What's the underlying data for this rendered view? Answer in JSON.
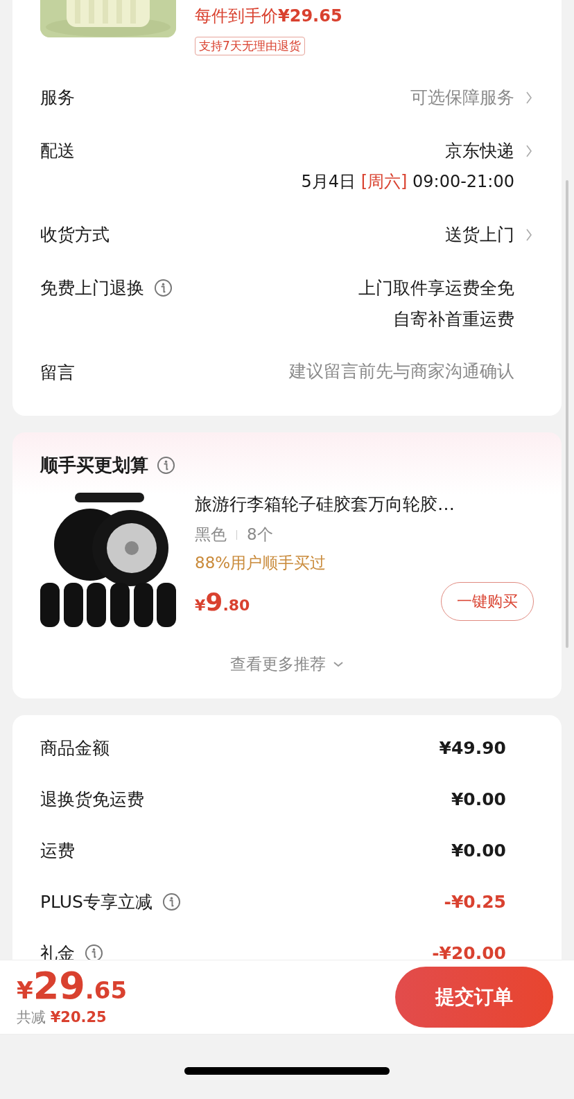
{
  "product": {
    "price_label": "每件到手价",
    "price": "¥29.65",
    "return_tag": "支持7天无理由退货"
  },
  "order_rows": [
    {
      "kind": "link",
      "label": "服务",
      "value": "可选保障服务",
      "muted": true
    },
    {
      "kind": "link",
      "label": "配送",
      "value": "京东快递",
      "muted": false,
      "date": "5月4日",
      "weekday": "[周六]",
      "time": "09:00-21:00"
    },
    {
      "kind": "link",
      "label": "收货方式",
      "value": "送货上门",
      "muted": false
    },
    {
      "kind": "info",
      "label": "免费上门退换",
      "lines": [
        "上门取件享运费全免",
        "自寄补首重运费"
      ]
    },
    {
      "kind": "input",
      "label": "留言",
      "placeholder": "建议留言前先与商家沟通确认"
    }
  ],
  "recommend": {
    "title": "顺手买更划算",
    "item": {
      "name": "旅游行李箱轮子硅胶套万向轮胶…",
      "spec": "黑色",
      "quantity": "8个",
      "social": "88%用户顺手买过",
      "currency": "¥",
      "price_int": "9",
      "price_dec": ".80",
      "button": "一键购买"
    },
    "more": "查看更多推荐"
  },
  "summary": [
    {
      "label": "商品金额",
      "value": "¥49.90",
      "discount": false,
      "info": false
    },
    {
      "label": "退换货免运费",
      "value": "¥0.00",
      "discount": false,
      "info": false
    },
    {
      "label": "运费",
      "value": "¥0.00",
      "discount": false,
      "info": false
    },
    {
      "label": "PLUS专享立减",
      "value": "-¥0.25",
      "discount": true,
      "info": true
    },
    {
      "label": "礼金",
      "value": "-¥20.00",
      "discount": true,
      "info": true
    }
  ],
  "footer": {
    "currency": "¥",
    "total_int": "29",
    "total_dec": ".65",
    "saved_label": "共减",
    "saved": "¥20.25",
    "submit": "提交订单"
  }
}
